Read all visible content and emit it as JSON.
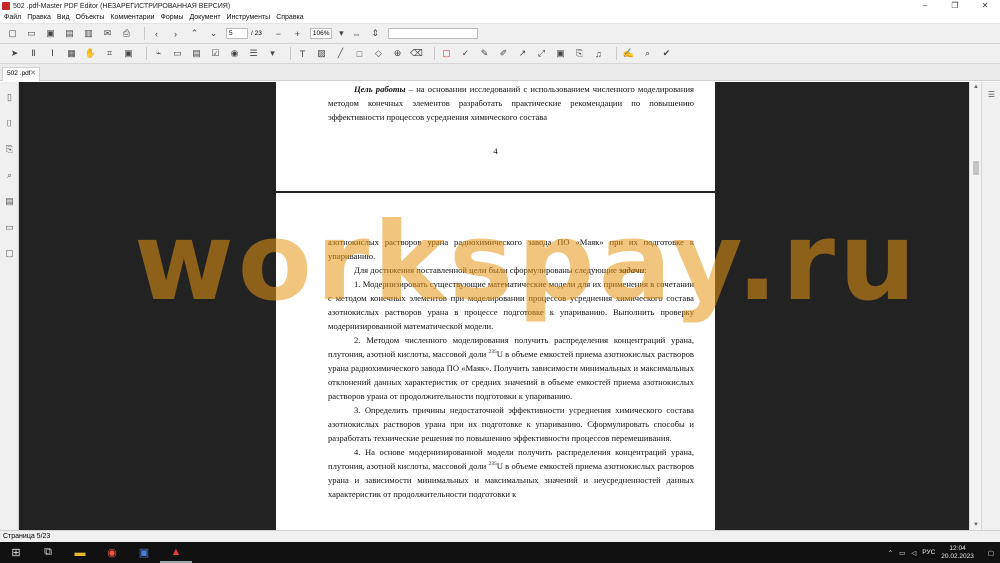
{
  "window": {
    "title": "502 .pdf-Master PDF Editor (НЕЗАРЕГИСТРИРОВАННАЯ ВЕРСИЯ)",
    "minimize": "–",
    "maximize": "❐",
    "close": "✕"
  },
  "menu": [
    "Файл",
    "Правка",
    "Вид",
    "Объекты",
    "Комментарии",
    "Формы",
    "Документ",
    "Инструменты",
    "Справка"
  ],
  "toolbar": {
    "page_current": "5",
    "page_total": "/ 23",
    "zoom": "106%",
    "search_placeholder": ""
  },
  "tab": {
    "label": "502 .pdf",
    "close": "✕"
  },
  "document": {
    "page4": {
      "paragraph_lead": "Цель работы",
      "paragraph_rest": " – на основании исследований с использованием численного моделирования методом конечных элементов разработать практические рекомендации по повышению эффективности процессов усреднения химического состава",
      "page_number": "4"
    },
    "page5": {
      "p0": "азотнокислых растворов урана радиохимического завода ПО «Маяк» при их подготовке к упариванию.",
      "p1_start": "Для достижения поставленной цели были сформулированы следующие ",
      "p1_emph": "задачи",
      "p1_end": ":",
      "p2": "1.  Модернизировать существующие математические модели для их применения в сочетании с методом конечных элементов при моделировании процессов усреднения химического состава азотнокислых растворов урана в процессе подготовке к упариванию. Выполнить проверку модернизированной математической модели.",
      "p3_a": "2.  Методом численного моделирования получить распределения концентраций урана, плутония, азотной кислоты, массовой доли ",
      "p3_sup": "235",
      "p3_b": "U в объеме емкостей приема азотнокислых растворов урана радиохимического завода ПО «Маяк». Получить зависимости минимальных и максимальных отклонений данных характеристик от средних значений в объеме емкостей приема азотнокислых растворов урана от продолжительности подготовки к упариванию.",
      "p4": "3.  Определить причины недостаточной эффективности усреднения химического состава азотнокислых растворов урана при их подготовке к упариванию. Сформулировать способы и разработать технические решения по повышению эффективности процессов перемешивания.",
      "p5_a": "4.  На основе модернизированной модели получить распределения концентраций урана, плутония, азотной кислоты, массовой доли ",
      "p5_sup": "235",
      "p5_b": "U в объеме емкостей приема азотнокислых растворов урана и зависимости минимальных и максимальных значений и неусредненностей данных характеристик от продолжительности подготовки к"
    },
    "watermark": "workspay.ru"
  },
  "status": {
    "page_info": "Страница 5/23"
  },
  "taskbar": {
    "lang": "РУС",
    "time": "12:04",
    "date": "20.02.2023"
  },
  "colors": {
    "canvas": "#222222",
    "watermark": "#e89614",
    "app_icon": "#c62828"
  }
}
